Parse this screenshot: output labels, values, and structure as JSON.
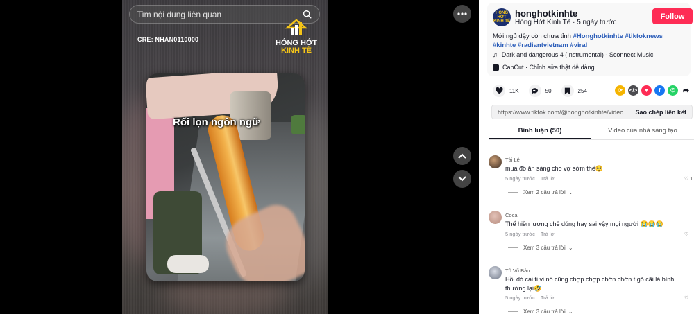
{
  "search": {
    "placeholder": "Tìm nội dung liên quan"
  },
  "video": {
    "credit": "CRE: NHAN0110000",
    "logo_line1": "HÓNG HỚT",
    "logo_line2": "KINH TẾ",
    "caption": "Rối lọn ngôn ngữ"
  },
  "author": {
    "username": "honghotkinhte",
    "nickname_time": "Hóng Hớt Kinh Tế · 5 ngày trước",
    "follow_label": "Follow",
    "avatar_text": "HÓNG HỚT KINH TẾ"
  },
  "description": {
    "text": "Mới ngủ dậy còn chưa tỉnh ",
    "hashtags": [
      "#Honghotkinhte",
      "#tiktoknews",
      "#kinhte",
      "#radiantvietnam",
      "#viral"
    ]
  },
  "music": {
    "title": "Dark and dangerous 4 (Instrumental) - Sconnect Music"
  },
  "capcut": {
    "label": "CapCut · Chỉnh sửa thật dễ dàng"
  },
  "stats": {
    "likes": "11K",
    "comments": "50",
    "saves": "254"
  },
  "link": {
    "url": "https://www.tiktok.com/@honghotkinhte/video...",
    "copy_label": "Sao chép liên kết"
  },
  "tabs": {
    "comments": "Bình luận (50)",
    "creator_videos": "Video của nhà sáng tạo"
  },
  "comments": [
    {
      "name": "Tài Lê",
      "text": "mua đồ ăn sáng cho vợ sớm thế🥺",
      "time": "5 ngày trước",
      "reply": "Trả lời",
      "more": "Xem 2 câu trả lời",
      "likes": "1"
    },
    {
      "name": "Coca",
      "text": "Thế hiền lương chê dúng hay sai vậy mọi người 😭😭😭",
      "time": "5 ngày trước",
      "reply": "Trả lời",
      "more": "Xem 3 câu trả lời",
      "likes": ""
    },
    {
      "name": "Tô Vũ Bảo",
      "text": "Hồi dó cái ti vi nó cũng chợp chợp chờn chờn t gõ cãi là bình thường lại🤣",
      "time": "5 ngày trước",
      "reply": "Trả lời",
      "more": "Xem 3 câu trả lời",
      "likes": ""
    }
  ],
  "colors": {
    "accent": "#fe2c55",
    "hashtag": "#2b5db9"
  }
}
